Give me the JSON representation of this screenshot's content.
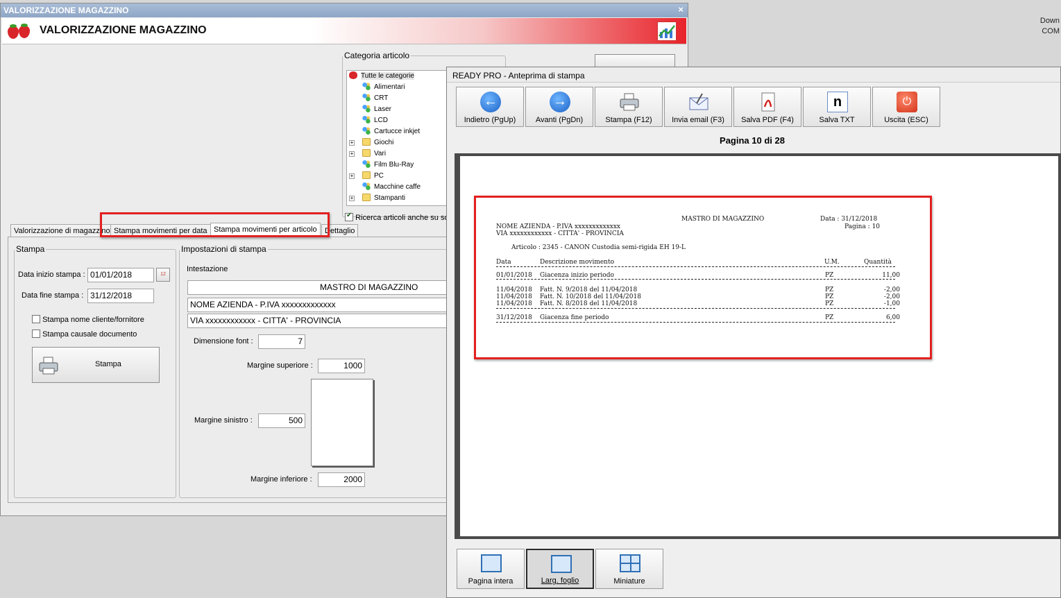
{
  "desktop": {
    "line1": "Down",
    "line2": "COM"
  },
  "main_window": {
    "titlebar": "VALORIZZAZIONE MAGAZZINO",
    "close_glyph": "×",
    "banner_title": "VALORIZZAZIONE MAGAZZINO",
    "category": {
      "legend": "Categoria articolo",
      "items": [
        {
          "label": "Tutte le categorie",
          "icon": "strawberry-icon"
        },
        {
          "label": "Alimentari",
          "icon": "network-icon"
        },
        {
          "label": "CRT",
          "icon": "network-icon"
        },
        {
          "label": "Laser",
          "icon": "network-icon"
        },
        {
          "label": "LCD",
          "icon": "network-icon"
        },
        {
          "label": "Cartucce inkjet",
          "icon": "network-icon"
        },
        {
          "label": "Giochi",
          "icon": "folder-icon"
        },
        {
          "label": "Vari",
          "icon": "folder-icon"
        },
        {
          "label": "Film Blu-Ray",
          "icon": "network-icon"
        },
        {
          "label": "PC",
          "icon": "folder-icon"
        },
        {
          "label": "Macchine caffe",
          "icon": "network-icon"
        },
        {
          "label": "Stampanti",
          "icon": "folder-icon"
        }
      ],
      "search_subcat_label": "Ricerca articoli anche su sot"
    },
    "tabs": [
      {
        "label": "Valorizzazione di magazzino"
      },
      {
        "label": "Stampa movimenti per data"
      },
      {
        "label": "Stampa movimenti per articolo"
      },
      {
        "label": "Dettaglio"
      }
    ],
    "stampa_group": {
      "legend": "Stampa",
      "data_inizio_label": "Data inizio stampa :",
      "data_inizio_value": "01/01/2018",
      "data_fine_label": "Data fine stampa :",
      "data_fine_value": "31/12/2018",
      "check_cliente": "Stampa nome cliente/fornitore",
      "check_causale": "Stampa causale documento",
      "print_button": "Stampa",
      "calendar_text": "12"
    },
    "impostazioni_group": {
      "legend": "Impostazioni di stampa",
      "intestazione_label": "Intestazione",
      "intestazione_lines": [
        "MASTRO DI MAGAZZINO",
        "NOME AZIENDA - P.IVA xxxxxxxxxxxxx",
        "VIA xxxxxxxxxxxx - CITTA' - PROVINCIA"
      ],
      "font_label": "Dimensione font :",
      "font_value": "7",
      "margin_top_label": "Margine superiore :",
      "margin_top_value": "1000",
      "margin_left_label": "Margine sinistro :",
      "margin_left_value": "500",
      "margin_bottom_label": "Margine inferiore :",
      "margin_bottom_value": "2000"
    }
  },
  "preview_window": {
    "title": "READY PRO - Anteprima di stampa",
    "toolbar": [
      {
        "label": "Indietro (PgUp)",
        "icon": "arrow-left-icon"
      },
      {
        "label": "Avanti (PgDn)",
        "icon": "arrow-right-icon"
      },
      {
        "label": "Stampa (F12)",
        "icon": "printer-icon"
      },
      {
        "label": "Invia email (F3)",
        "icon": "email-icon"
      },
      {
        "label": "Salva PDF (F4)",
        "icon": "pdf-icon"
      },
      {
        "label": "Salva TXT",
        "icon": "txt-icon"
      },
      {
        "label": "Uscita (ESC)",
        "icon": "exit-icon"
      }
    ],
    "glyphs": {
      "left": "←",
      "right": "→",
      "txt": "n",
      "exit": "⏻"
    },
    "page_indicator": "Pagina 10 di 28",
    "report": {
      "title": "MASTRO DI MAGAZZINO",
      "date_label": "Data : 31/12/2018",
      "page_label": "Pagina : 10",
      "company_line": "NOME AZIENDA - P.IVA xxxxxxxxxxxxx",
      "address_line": "VIA xxxxxxxxxxxx - CITTA' - PROVINCIA",
      "article_line": "Articolo : 2345 - CANON Custodia semi-rigida EH 19-L",
      "columns": {
        "date": "Data",
        "desc": "Descrizione movimento",
        "um": "U.M.",
        "qty": "Quantità"
      },
      "rows": [
        {
          "date": "01/01/2018",
          "desc": "Giacenza inizio periodo",
          "um": "PZ",
          "qty": "11,00"
        },
        {
          "date": "11/04/2018",
          "desc": "Fatt. N. 9/2018 del 11/04/2018",
          "um": "PZ",
          "qty": "-2,00"
        },
        {
          "date": "11/04/2018",
          "desc": "Fatt. N. 10/2018 del 11/04/2018",
          "um": "PZ",
          "qty": "-2,00"
        },
        {
          "date": "11/04/2018",
          "desc": "Fatt. N. 8/2018 del 11/04/2018",
          "um": "PZ",
          "qty": "-1,00"
        },
        {
          "date": "31/12/2018",
          "desc": "Giacenza fine periodo",
          "um": "PZ",
          "qty": "6,00"
        }
      ]
    },
    "view_buttons": [
      {
        "label": "Pagina intera"
      },
      {
        "label": "Larg. foglio"
      },
      {
        "label": "Miniature"
      }
    ]
  },
  "colors": {
    "highlight": "#e2201f",
    "accent_blue": "#1c62c7"
  }
}
